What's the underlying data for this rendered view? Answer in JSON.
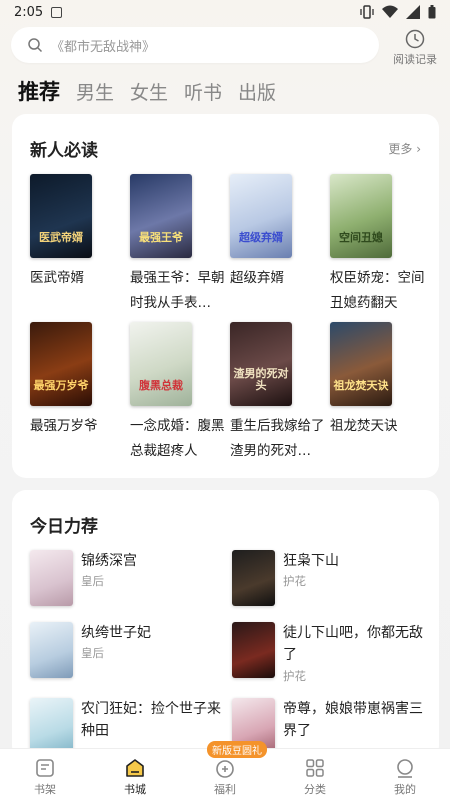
{
  "status_bar": {
    "time": "2:05"
  },
  "search": {
    "placeholder": "《都市无敌战神》",
    "history_label": "阅读记录"
  },
  "top_tabs": [
    "推荐",
    "男生",
    "女生",
    "听书",
    "出版"
  ],
  "new_reader": {
    "title": "新人必读",
    "more": "更多",
    "books": [
      {
        "title": "医武帝婿",
        "cover_text": "医武帝婿"
      },
      {
        "title": "最强王爷：早朝时我从手表…",
        "cover_text": "最强王爷"
      },
      {
        "title": "超级弃婿",
        "cover_text": "超级弃婿"
      },
      {
        "title": "权臣娇宠：空间丑媳药翻天",
        "cover_text": "空间丑媳"
      },
      {
        "title": "最强万岁爷",
        "cover_text": "最强万岁爷"
      },
      {
        "title": "一念成婚：腹黑总裁超疼人",
        "cover_text": "腹黑总裁"
      },
      {
        "title": "重生后我嫁给了渣男的死对…",
        "cover_text": "渣男的死对头"
      },
      {
        "title": "祖龙焚天诀",
        "cover_text": "祖龙焚天诀"
      }
    ]
  },
  "today": {
    "title": "今日力荐",
    "items": [
      {
        "title": "锦绣深宫",
        "tag": "皇后"
      },
      {
        "title": "狂枭下山",
        "tag": "护花"
      },
      {
        "title": "纨绔世子妃",
        "tag": "皇后"
      },
      {
        "title": "徒儿下山吧，你都无敌了",
        "tag": "护花"
      },
      {
        "title": "农门狂妃：捡个世子来种田",
        "tag": ""
      },
      {
        "title": "帝尊，娘娘带崽祸害三界了",
        "tag": ""
      }
    ]
  },
  "bottom_nav": {
    "items": [
      "书架",
      "书城",
      "福利",
      "分类",
      "我的"
    ],
    "badge": "新版豆圆礼"
  }
}
